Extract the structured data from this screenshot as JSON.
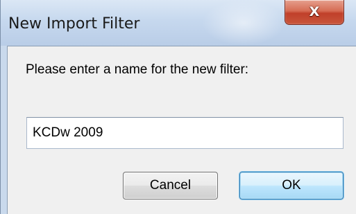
{
  "window": {
    "title": "New Import Filter",
    "close_glyph": "X",
    "close_icon": "close-icon"
  },
  "dialog": {
    "prompt": "Please enter a name for the new filter:",
    "filter_name_value": "KCDw 2009",
    "cancel_label": "Cancel",
    "ok_label": "OK"
  },
  "colors": {
    "titlebar": "#c6d8ee",
    "client": "#f0f0f0",
    "close_button": "#c8553b",
    "ok_button": "#bee6fd",
    "ok_border": "#3c7fb1"
  }
}
